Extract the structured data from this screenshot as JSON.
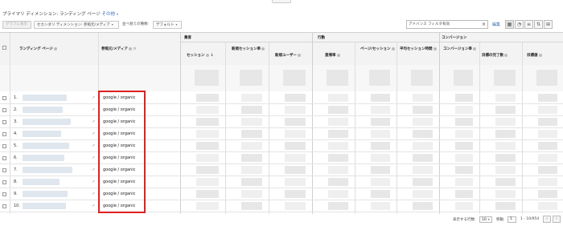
{
  "dimensions": {
    "primary_label": "プライマリ ディメンション:",
    "primary_value": "ランディング ページ",
    "other_link": "その他"
  },
  "toolbar": {
    "plot_rows": "グラフに表示",
    "secondary_dim": "セカンダリ ディメンション: 参照元/メディア",
    "sort_type_label": "並べ替えの種類:",
    "sort_type_value": "デフォルト",
    "filter_value": "アドバンス フィルタ有効",
    "edit_link": "編集"
  },
  "table": {
    "col_landing_page": "ランディング ページ",
    "col_source_medium": "参照元/メディア",
    "group_acquisition": "集客",
    "group_behavior": "行動",
    "group_conversion": "コンバージョン",
    "metrics": [
      "セッション",
      "新規セッション率",
      "新規ユーザー",
      "直帰率",
      "ページ/セッション",
      "平均セッション時間",
      "コンバージョン率",
      "目標の完了数",
      "目標値"
    ],
    "rows": [
      {
        "num": "1.",
        "source": "google / organic"
      },
      {
        "num": "2.",
        "source": "google / organic"
      },
      {
        "num": "3.",
        "source": "google / organic"
      },
      {
        "num": "4.",
        "source": "google / organic"
      },
      {
        "num": "5.",
        "source": "google / organic"
      },
      {
        "num": "6.",
        "source": "google / organic"
      },
      {
        "num": "7.",
        "source": "google / organic"
      },
      {
        "num": "8.",
        "source": "google / organic"
      },
      {
        "num": "9.",
        "source": "google / organic"
      },
      {
        "num": "10.",
        "source": "google / organic"
      }
    ]
  },
  "pager": {
    "rows_label": "表示する行数:",
    "rows_value": "10",
    "goto_label": "移動:",
    "goto_value": "1",
    "range": "1 - 10/954"
  },
  "colors": {
    "highlight": "#e02020",
    "link": "#3a6fb0"
  }
}
